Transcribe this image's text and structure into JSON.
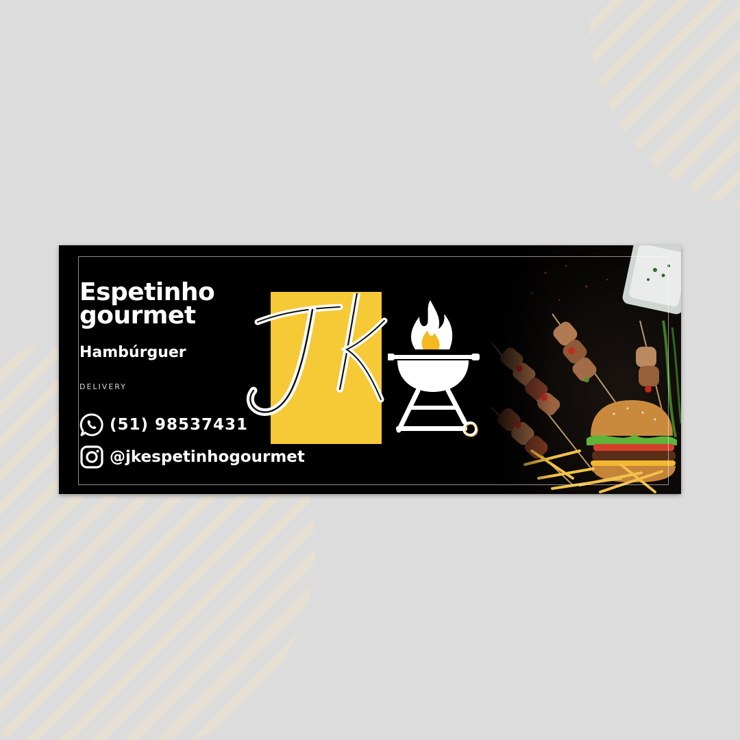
{
  "brand": {
    "title_line1": "Espetinho",
    "title_line2": "gourmet",
    "subtitle": "Hambúrguer",
    "tagline": "DELIVERY"
  },
  "logo": {
    "monogram": "JK",
    "accent_color": "#f6c937"
  },
  "contacts": {
    "phone": "(51) 98537431",
    "phone_icon": "whatsapp-icon",
    "instagram": "@jkespetinhogourmet",
    "instagram_icon": "instagram-icon"
  },
  "colors": {
    "background": "#dcdcdc",
    "banner": "#000000",
    "accent": "#f6c937",
    "text": "#ffffff"
  }
}
